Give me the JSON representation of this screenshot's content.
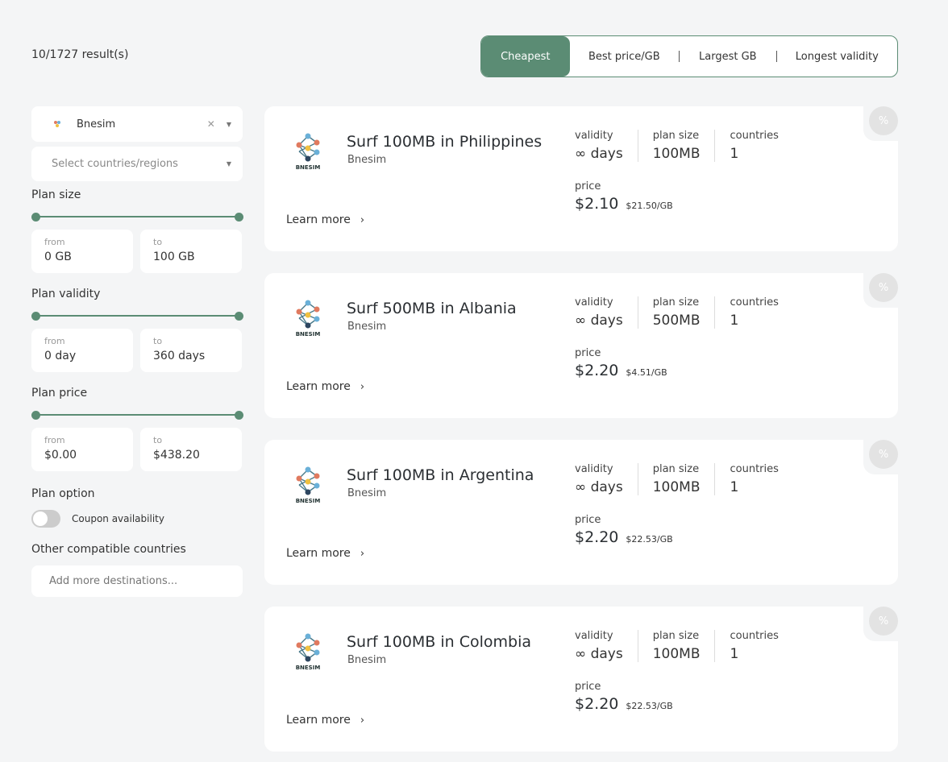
{
  "results": {
    "count": "10/1727 result(s)"
  },
  "sort": {
    "tabs": [
      "Cheapest",
      "Best price/GB",
      "Largest GB",
      "Longest validity"
    ],
    "active": 0
  },
  "sidebar": {
    "provider_select": "Bnesim",
    "countries_placeholder": "Select countries/regions",
    "plan_size": {
      "label": "Plan size",
      "from_label": "from",
      "from": "0 GB",
      "to_label": "to",
      "to": "100 GB"
    },
    "plan_validity": {
      "label": "Plan validity",
      "from_label": "from",
      "from": "0 day",
      "to_label": "to",
      "to": "360 days"
    },
    "plan_price": {
      "label": "Plan price",
      "from_label": "from",
      "from": "$0.00",
      "to_label": "to",
      "to": "$438.20"
    },
    "plan_option": {
      "label": "Plan option",
      "toggle_label": "Coupon availability",
      "toggle_on": false
    },
    "other_countries": {
      "label": "Other compatible countries",
      "placeholder": "Add more destinations..."
    }
  },
  "labels": {
    "validity": "validity",
    "plan_size": "plan size",
    "countries": "countries",
    "price": "price",
    "learn_more": "Learn more",
    "badge": "%",
    "logo_text": "BNESIM"
  },
  "plans": [
    {
      "title": "Surf 100MB in Philippines",
      "provider": "Bnesim",
      "validity": "∞ days",
      "size": "100MB",
      "countries": "1",
      "price": "$2.10",
      "per_gb": "$21.50/GB"
    },
    {
      "title": "Surf 500MB in Albania",
      "provider": "Bnesim",
      "validity": "∞ days",
      "size": "500MB",
      "countries": "1",
      "price": "$2.20",
      "per_gb": "$4.51/GB"
    },
    {
      "title": "Surf 100MB in Argentina",
      "provider": "Bnesim",
      "validity": "∞ days",
      "size": "100MB",
      "countries": "1",
      "price": "$2.20",
      "per_gb": "$22.53/GB"
    },
    {
      "title": "Surf 100MB in Colombia",
      "provider": "Bnesim",
      "validity": "∞ days",
      "size": "100MB",
      "countries": "1",
      "price": "$2.20",
      "per_gb": "$22.53/GB"
    }
  ],
  "colors": {
    "accent": "#5b8c74",
    "background": "#f4f5f6",
    "badge": "#e3e3e3"
  }
}
